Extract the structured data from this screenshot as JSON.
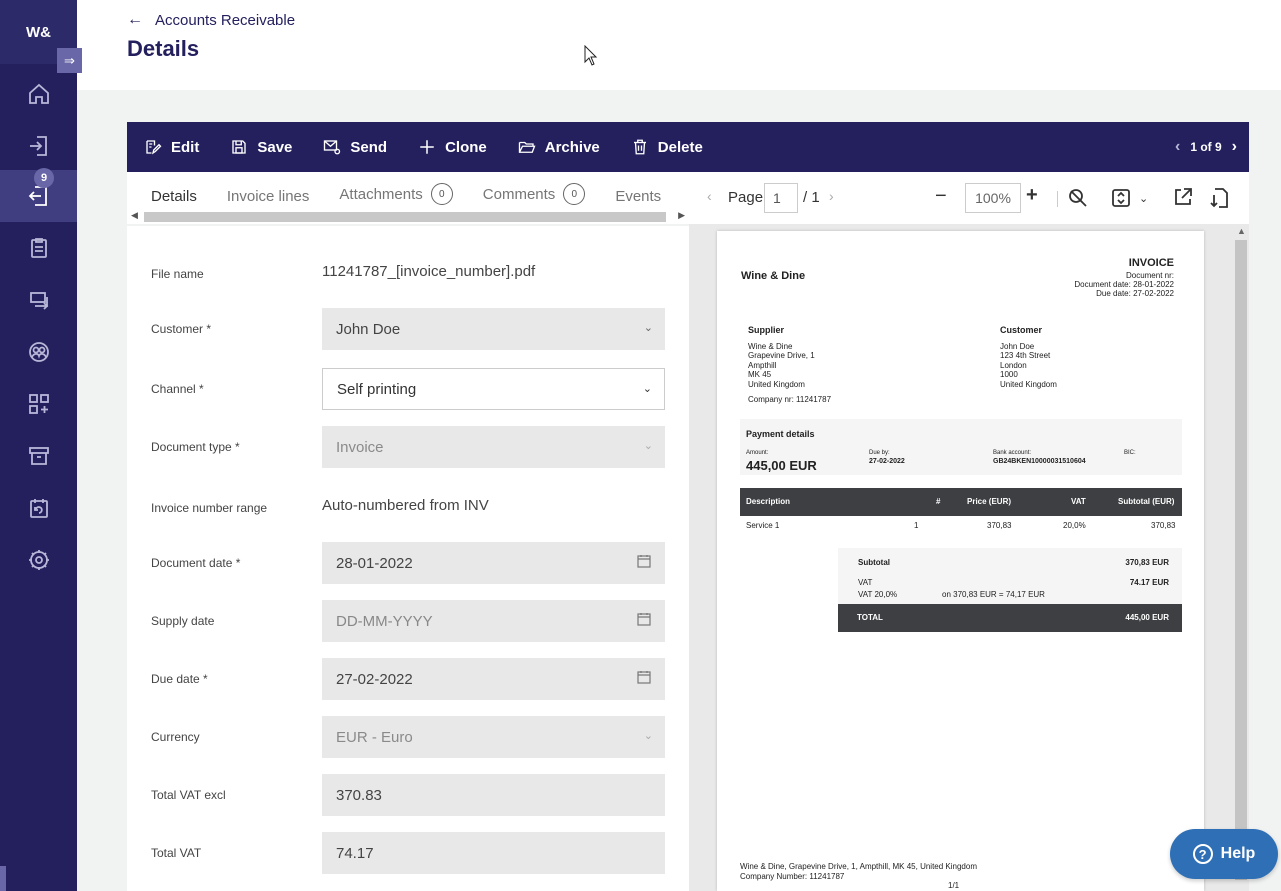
{
  "app": {
    "logo": "W&",
    "nav_badge_count": "9"
  },
  "header": {
    "back_label": "Accounts Receivable",
    "title": "Details"
  },
  "toolbar": {
    "edit": "Edit",
    "save": "Save",
    "send": "Send",
    "clone": "Clone",
    "archive": "Archive",
    "delete": "Delete",
    "pager": "1 of 9"
  },
  "tabs": [
    {
      "label": "Details"
    },
    {
      "label": "Invoice lines"
    },
    {
      "label": "Attachments",
      "count": "0"
    },
    {
      "label": "Comments",
      "count": "0"
    },
    {
      "label": "Events"
    }
  ],
  "form": {
    "file_name": {
      "label": "File name",
      "value": "11241787_[invoice_number].pdf"
    },
    "customer": {
      "label": "Customer *",
      "value": "John Doe"
    },
    "channel": {
      "label": "Channel *",
      "value": "Self printing"
    },
    "document_type": {
      "label": "Document type *",
      "value": "Invoice"
    },
    "invoice_number_range": {
      "label": "Invoice number range",
      "value": "Auto-numbered from INV"
    },
    "document_date": {
      "label": "Document date *",
      "value": "28-01-2022"
    },
    "supply_date": {
      "label": "Supply date",
      "placeholder": "DD-MM-YYYY"
    },
    "due_date": {
      "label": "Due date *",
      "value": "27-02-2022"
    },
    "currency": {
      "label": "Currency",
      "value": "EUR - Euro"
    },
    "total_vat_excl": {
      "label": "Total VAT excl",
      "value": "370.83"
    },
    "total_vat": {
      "label": "Total VAT",
      "value": "74.17"
    }
  },
  "viewer": {
    "page_label": "Page",
    "page_value": "1",
    "page_total": "/ 1",
    "zoom": "100%"
  },
  "document": {
    "company": "Wine & Dine",
    "heading": "INVOICE",
    "doc_nr": "Document nr:",
    "doc_date": "Document date: 28-01-2022",
    "due_date": "Due date: 27-02-2022",
    "supplier_title": "Supplier",
    "supplier_lines": [
      "Wine & Dine",
      "Grapevine Drive, 1",
      "Ampthill",
      "MK 45",
      "United Kingdom"
    ],
    "company_nr": "Company nr: 11241787",
    "customer_title": "Customer",
    "customer_lines": [
      "John Doe",
      "123 4th Street",
      "London",
      "1000",
      "United Kingdom"
    ],
    "payment_title": "Payment details",
    "amount_label": "Amount:",
    "amount_value": "445,00 EUR",
    "due_by_label": "Due by:",
    "due_by_value": "27-02-2022",
    "bank_label": "Bank account:",
    "bank_value": "GB24BKEN10000031510604",
    "bic_label": "BIC:",
    "table_headers": [
      "Description",
      "#",
      "Price (EUR)",
      "VAT",
      "Subtotal (EUR)"
    ],
    "table_row": [
      "Service 1",
      "1",
      "370,83",
      "20,0%",
      "370,83"
    ],
    "subtotal_label": "Subtotal",
    "subtotal_value": "370,83 EUR",
    "vat_label": "VAT",
    "vat_value": "74.17 EUR",
    "vat_rate": "VAT 20,0%",
    "vat_detail": "on 370,83 EUR = 74,17 EUR",
    "total_label": "TOTAL",
    "total_value": "445,00 EUR",
    "footer_address": "Wine & Dine, Grapevine Drive, 1,   Ampthill,  MK 45, United Kingdom",
    "footer_company": "Company Number: 11241787",
    "page_indicator": "1/1"
  },
  "help": {
    "label": "Help"
  }
}
